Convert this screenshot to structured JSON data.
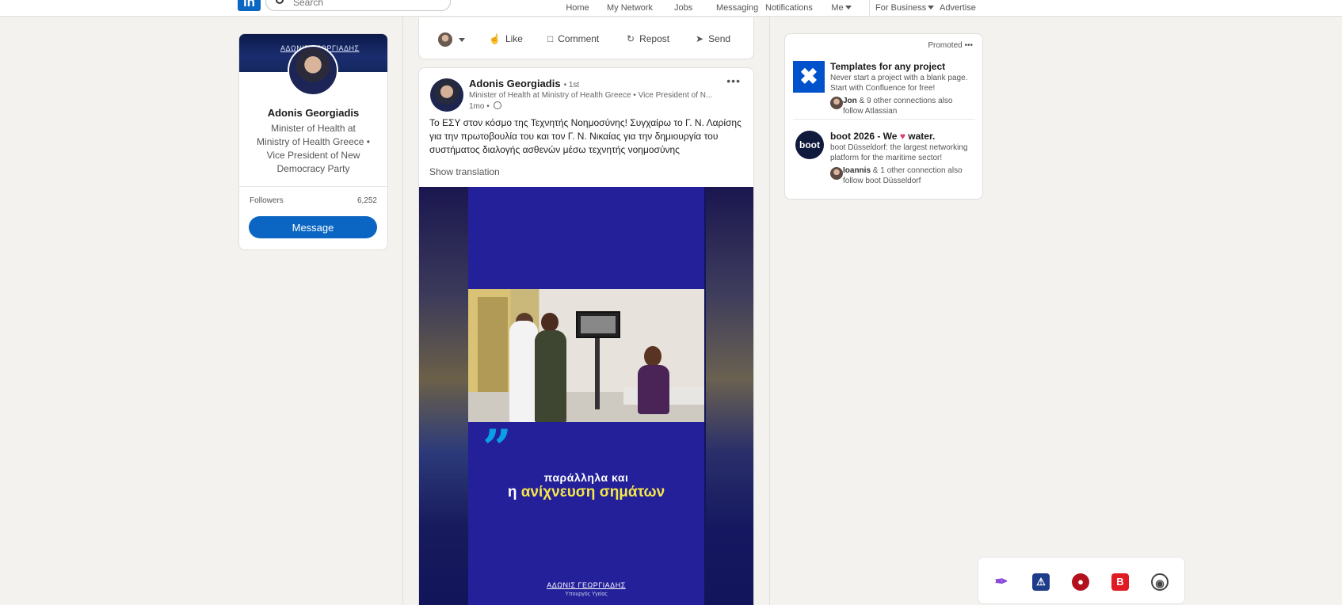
{
  "nav": {
    "search_placeholder": "Search",
    "items": {
      "home": "Home",
      "network": "My Network",
      "jobs": "Jobs",
      "messaging": "Messaging",
      "notifications": "Notifications",
      "me": "Me",
      "business": "For Business",
      "advertise": "Advertise"
    },
    "brand_color": "#0a66c2"
  },
  "profile": {
    "banner_text": "ΑΔΩΝΙΣ ΓΕΩΡΓΙΑΔΗΣ",
    "name": "Adonis Georgiadis",
    "headline": "Minister of Health at Ministry of Health Greece • Vice President of New Democracy Party",
    "followers_label": "Followers",
    "followers_value": "6,252",
    "message_button": "Message"
  },
  "actions": {
    "like": "Like",
    "comment": "Comment",
    "repost": "Repost",
    "send": "Send"
  },
  "post": {
    "author": "Adonis Georgiadis",
    "degree": "• 1st",
    "subtitle": "Minister of Health at Ministry of Health Greece • Vice President of N...",
    "time": "1mo •",
    "more": "•••",
    "text": "Το ΕΣΥ στον κόσμο της Τεχνητής Νοημοσύνης! Συγχαίρω το Γ. Ν. Λαρίσης για την πρωτοβουλία του και τον Γ. Ν. Νικαίας για την δημιουργία του συστήματος διαλογής ασθενών μέσω τεχνητής νοημοσύνης",
    "show_translation": "Show translation",
    "video": {
      "line1": "παράλληλα και",
      "line2_prefix": "η",
      "line2_highlight": "ανίχνευση σημάτων",
      "signature": "ΑΔΩΝΙΣ ΓΕΩΡΓΙΑΔΗΣ",
      "signature_sub": "Υπουργός Υγείας"
    }
  },
  "promoted": {
    "label": "Promoted",
    "more": "•••",
    "ads": [
      {
        "title": "Templates for any project",
        "body": "Never start a project with a blank page. Start with Confluence for free!",
        "connection_name": "Jon",
        "connection_text": "& 9 other connections also follow Atlassian"
      },
      {
        "logo_text": "boot",
        "title_prefix": "boot 2026 - We",
        "title_heart": "♥",
        "title_suffix": "water.",
        "body": "boot Düsseldorf: the largest networking platform for the maritime sector!",
        "connection_name": "Ioannis",
        "connection_text": "& 1 other connection also follow boot Düsseldorf"
      }
    ]
  }
}
